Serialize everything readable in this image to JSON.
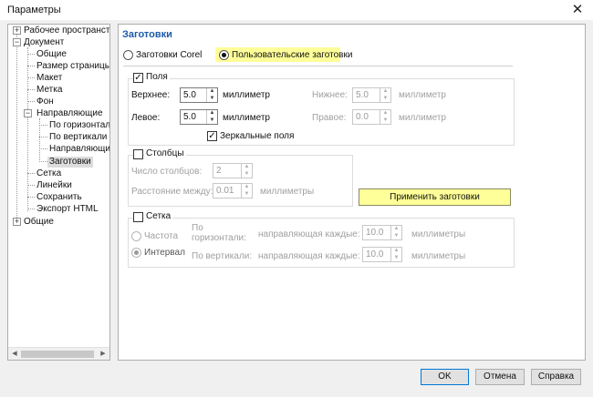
{
  "window": {
    "title": "Параметры"
  },
  "tree": {
    "items": [
      {
        "label": "Рабочее пространство"
      },
      {
        "label": "Документ"
      },
      {
        "label": "Общие"
      },
      {
        "label": "Размер страницы"
      },
      {
        "label": "Макет"
      },
      {
        "label": "Метка"
      },
      {
        "label": "Фон"
      },
      {
        "label": "Направляющие"
      },
      {
        "label": "По горизонтали"
      },
      {
        "label": "По вертикали"
      },
      {
        "label": "Направляющие"
      },
      {
        "label": "Заготовки"
      },
      {
        "label": "Сетка"
      },
      {
        "label": "Линейки"
      },
      {
        "label": "Сохранить"
      },
      {
        "label": "Экспорт HTML"
      },
      {
        "label": "Общие"
      }
    ],
    "selected": "Заготовки"
  },
  "panel": {
    "title": "Заготовки",
    "preset_corel": "Заготовки Corel",
    "preset_user": "Пользовательские заготовки",
    "margins": {
      "label": "Поля",
      "top_label": "Верхнее:",
      "top_value": "5.0",
      "top_unit": "миллиметр",
      "left_label": "Левое:",
      "left_value": "5.0",
      "left_unit": "миллиметр",
      "bottom_label": "Нижнее:",
      "bottom_value": "5.0",
      "bottom_unit": "миллиметр",
      "right_label": "Правое:",
      "right_value": "0.0",
      "right_unit": "миллиметр",
      "mirror_label": "Зеркальные поля"
    },
    "columns": {
      "label": "Столбцы",
      "count_label": "Число столбцов:",
      "count_value": "2",
      "gap_label": "Расстояние между:",
      "gap_value": "0.01",
      "gap_unit": "миллиметры"
    },
    "apply_label": "Применить заготовки",
    "grid": {
      "label": "Сетка",
      "freq_label": "Частота",
      "interval_label": "Интервал",
      "horiz_label_1": "По",
      "horiz_label_2": "горизонтали:",
      "vert_label": "По вертикали:",
      "every_label_1": "направляющая каждые:",
      "every_label_2": "направляющая каждые:",
      "horiz_value": "10.0",
      "vert_value": "10.0",
      "unit_1": "миллиметры",
      "unit_2": "миллиметры"
    }
  },
  "buttons": {
    "ok": "OK",
    "cancel": "Отмена",
    "help": "Справка"
  }
}
